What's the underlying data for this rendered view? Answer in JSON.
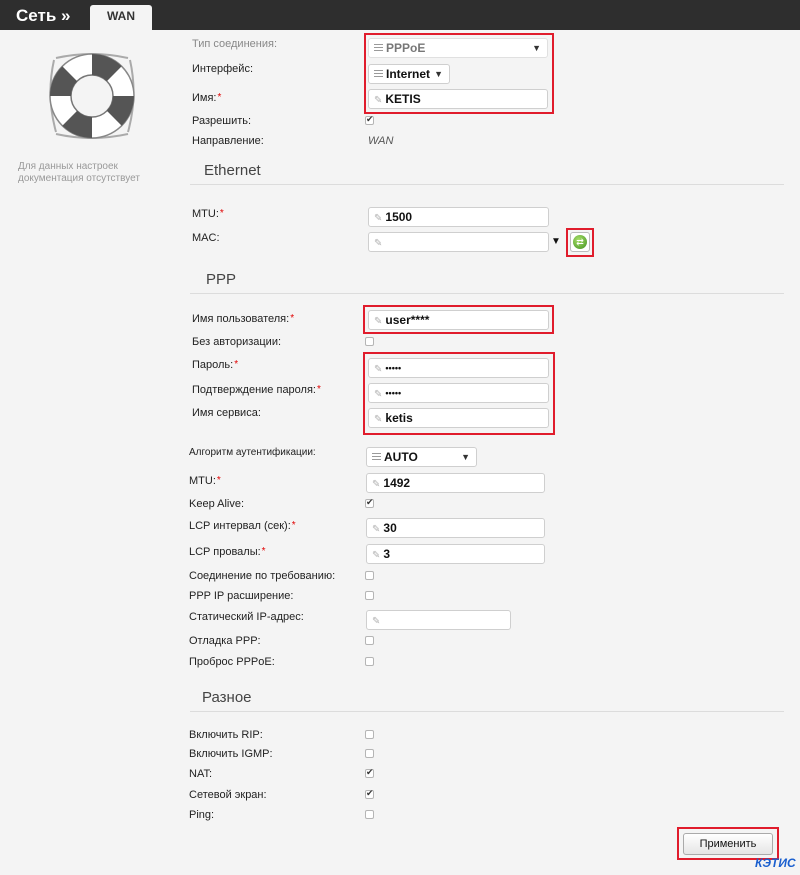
{
  "header": {
    "title": "Сеть »",
    "tab": "WAN"
  },
  "side_note": "Для данных настроек документация отсутствует",
  "general": {
    "conn_type": {
      "label": "Тип соединения:",
      "value": "PPPoE"
    },
    "interface": {
      "label": "Интерфейс:",
      "value": "Internet"
    },
    "name": {
      "label": "Имя:",
      "value": "KETIS"
    },
    "enable": {
      "label": "Разрешить:",
      "checked": true
    },
    "direction": {
      "label": "Направление:",
      "value": "WAN"
    }
  },
  "ethernet": {
    "title": "Ethernet",
    "mtu": {
      "label": "MTU:",
      "value": "1500"
    },
    "mac": {
      "label": "MAC:",
      "value": ""
    }
  },
  "ppp": {
    "title": "PPP",
    "username": {
      "label": "Имя пользователя:",
      "value": "user****"
    },
    "no_auth": {
      "label": "Без авторизации:",
      "checked": false
    },
    "password": {
      "label": "Пароль:",
      "value": "•••••"
    },
    "password_confirm": {
      "label": "Подтверждение пароля:",
      "value": "•••••"
    },
    "service_name": {
      "label": "Имя сервиса:",
      "value": "ketis"
    },
    "auth_algo": {
      "label": "Алгоритм аутентификации:",
      "value": "AUTO"
    },
    "mtu": {
      "label": "MTU:",
      "value": "1492"
    },
    "keep_alive": {
      "label": "Keep Alive:",
      "checked": true
    },
    "lcp_interval": {
      "label": "LCP интервал (сек):",
      "value": "30"
    },
    "lcp_fails": {
      "label": "LCP провалы:",
      "value": "3"
    },
    "on_demand": {
      "label": "Соединение по требованию:",
      "checked": false
    },
    "ip_extension": {
      "label": "PPP IP расширение:",
      "checked": false
    },
    "static_ip": {
      "label": "Статический IP-адрес:",
      "value": ""
    },
    "debug": {
      "label": "Отладка PPP:",
      "checked": false
    },
    "passthrough": {
      "label": "Проброс PPPoE:",
      "checked": false
    }
  },
  "misc": {
    "title": "Разное",
    "rip": {
      "label": "Включить RIP:",
      "checked": false
    },
    "igmp": {
      "label": "Включить IGMP:",
      "checked": false
    },
    "nat": {
      "label": "NAT:",
      "checked": true
    },
    "firewall": {
      "label": "Сетевой экран:",
      "checked": true
    },
    "ping": {
      "label": "Ping:",
      "checked": false
    }
  },
  "apply_label": "Применить",
  "watermark": "КЭТИС",
  "required_mark": "*"
}
